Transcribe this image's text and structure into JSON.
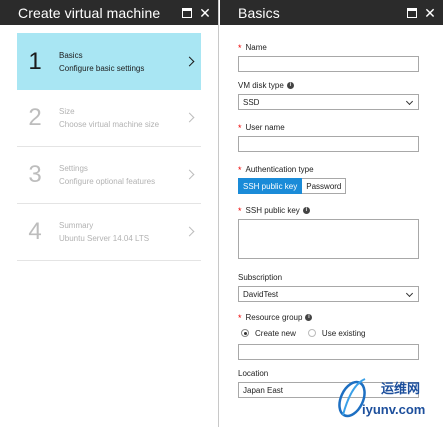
{
  "left_blade": {
    "title": "Create virtual machine",
    "steps": [
      {
        "number": "1",
        "title": "Basics",
        "description": "Configure basic settings",
        "active": true
      },
      {
        "number": "2",
        "title": "Size",
        "description": "Choose virtual machine size",
        "active": false
      },
      {
        "number": "3",
        "title": "Settings",
        "description": "Configure optional features",
        "active": false
      },
      {
        "number": "4",
        "title": "Summary",
        "description": "Ubuntu Server 14.04 LTS",
        "active": false
      }
    ]
  },
  "right_blade": {
    "title": "Basics",
    "required_marker": "*",
    "info_glyph": "i",
    "name": {
      "label": "Name",
      "value": ""
    },
    "vm_disk_type": {
      "label": "VM disk type",
      "value": "SSD"
    },
    "user_name": {
      "label": "User name",
      "value": ""
    },
    "authentication_type": {
      "label": "Authentication type",
      "options": [
        "SSH public key",
        "Password"
      ],
      "selected": "SSH public key"
    },
    "ssh_public_key": {
      "label": "SSH public key",
      "value": ""
    },
    "subscription": {
      "label": "Subscription",
      "value": "DavidTest"
    },
    "resource_group": {
      "label": "Resource group",
      "options": [
        "Create new",
        "Use existing"
      ],
      "selected": "Create new",
      "value": ""
    },
    "location": {
      "label": "Location",
      "value": "Japan East"
    }
  },
  "watermark": {
    "text_cn": "运维网",
    "text_en": "iyunv.com"
  },
  "colors": {
    "header_bg": "#2b2b2b",
    "active_step_bg": "#a9e6f3",
    "toggle_selected": "#1a8bd8",
    "required": "#e00000"
  }
}
